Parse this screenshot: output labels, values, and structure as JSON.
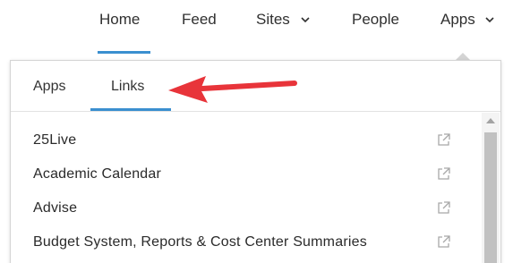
{
  "nav": {
    "items": [
      {
        "label": "Home"
      },
      {
        "label": "Feed"
      },
      {
        "label": "Sites"
      },
      {
        "label": "People"
      },
      {
        "label": "Apps"
      }
    ]
  },
  "panel": {
    "tabs": [
      {
        "label": "Apps"
      },
      {
        "label": "Links"
      }
    ],
    "links": [
      {
        "label": "25Live"
      },
      {
        "label": "Academic Calendar"
      },
      {
        "label": "Advise"
      },
      {
        "label": "Budget System, Reports & Cost Center Summaries"
      }
    ]
  },
  "colors": {
    "accent": "#3a8fcf",
    "callout_arrow": "#e8343a",
    "text": "#2f2f2f",
    "icon": "#a8a8a8"
  },
  "icons": {
    "dropdown": "chevron-down-icon",
    "link": "external-link-icon",
    "annotation": "red-arrow-icon"
  }
}
